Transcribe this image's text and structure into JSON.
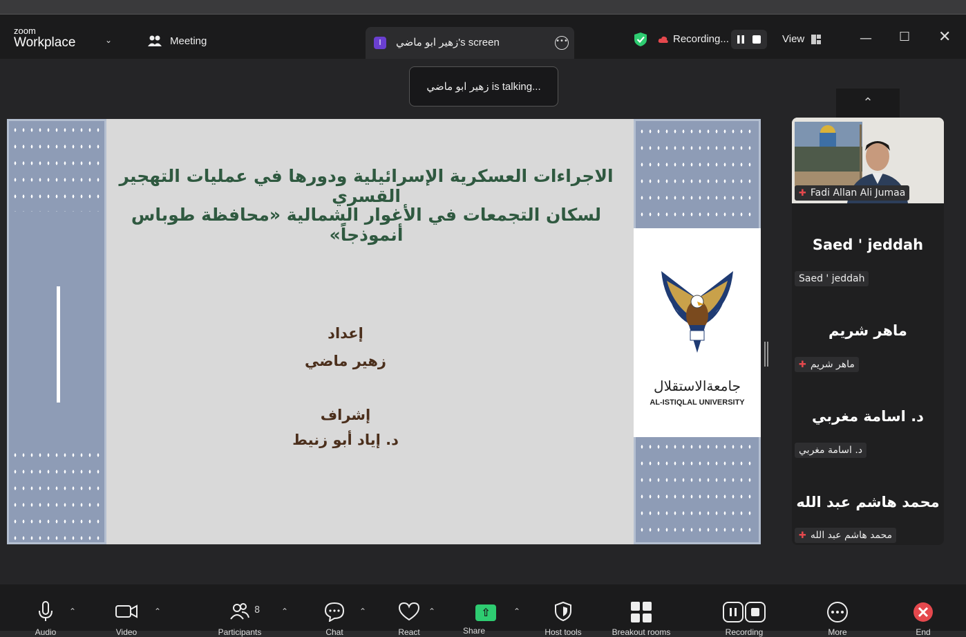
{
  "app": {
    "brand_small": "zoom",
    "brand_big": "Workplace",
    "meeting_label": "Meeting"
  },
  "tab": {
    "initial": "I",
    "title": "زهير ابو ماضي's screen"
  },
  "recording": {
    "label": "Recording..."
  },
  "view": {
    "label": "View"
  },
  "talking": {
    "text": "زهير ابو ماضي is talking..."
  },
  "slide": {
    "title_line1": "الاجراءات العسكرية الإسرائيلية ودورها في عمليات التهجير القسري",
    "title_line2": "لسكان التجمعات في الأغوار الشمالية «محافظة طوباس أنموذجاً»",
    "prepared_label": "إعداد",
    "author": "زهير ماضي",
    "supervision_label": "إشراف",
    "supervisor": "د. إياد أبو زنيط",
    "uni_ar": "جامعةالاستقلال",
    "uni_en": "AL-ISTIQLAL UNIVERSITY"
  },
  "participants": [
    {
      "tile_name": "",
      "tag": "Fadi Allan Ali Jumaa",
      "muted": true
    },
    {
      "tile_name": "Saed ' jeddah",
      "tag": "Saed ' jeddah",
      "muted": false
    },
    {
      "tile_name": "ماهر شريم",
      "tag": "ماهر شريم",
      "muted": true
    },
    {
      "tile_name": "د. اسامة مغربي",
      "tag": "د. اسامة مغربي",
      "muted": false
    },
    {
      "tile_name": "محمد هاشم عبد الله",
      "tag": "محمد هاشم عبد الله",
      "muted": true
    }
  ],
  "toolbar": {
    "participants_count": "8",
    "items": [
      "Audio",
      "Video",
      "Participants",
      "Chat",
      "React",
      "Share",
      "Host tools",
      "Breakout rooms",
      "Recording",
      "More",
      "End"
    ]
  }
}
